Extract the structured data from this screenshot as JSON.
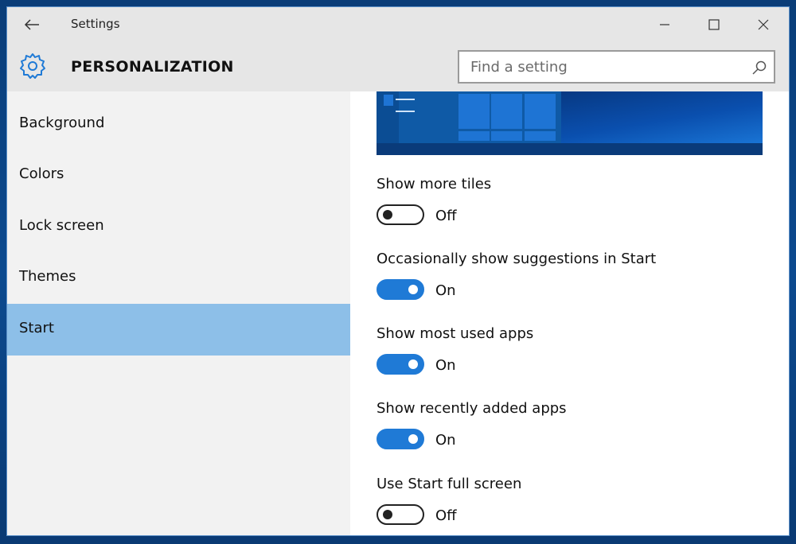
{
  "window": {
    "title": "Settings",
    "back_icon": "back-arrow-icon",
    "minimize_icon": "minimize-icon",
    "maximize_icon": "maximize-icon",
    "close_icon": "close-icon"
  },
  "header": {
    "icon": "gear-icon",
    "title": "PERSONALIZATION",
    "search_placeholder": "Find a setting",
    "search_icon": "search-icon"
  },
  "sidebar": {
    "items": [
      {
        "label": "Background",
        "selected": false
      },
      {
        "label": "Colors",
        "selected": false
      },
      {
        "label": "Lock screen",
        "selected": false
      },
      {
        "label": "Themes",
        "selected": false
      },
      {
        "label": "Start",
        "selected": true
      }
    ]
  },
  "settings": [
    {
      "label": "Show more tiles",
      "state": "Off",
      "on": false
    },
    {
      "label": "Occasionally show suggestions in Start",
      "state": "On",
      "on": true
    },
    {
      "label": "Show most used apps",
      "state": "On",
      "on": true
    },
    {
      "label": "Show recently added apps",
      "state": "On",
      "on": true
    },
    {
      "label": "Use Start full screen",
      "state": "Off",
      "on": false
    }
  ],
  "colors": {
    "accent": "#1f7ad6",
    "selected_nav": "#8dbfe8",
    "chrome": "#e6e6e6",
    "sidebar": "#f2f2f2"
  }
}
